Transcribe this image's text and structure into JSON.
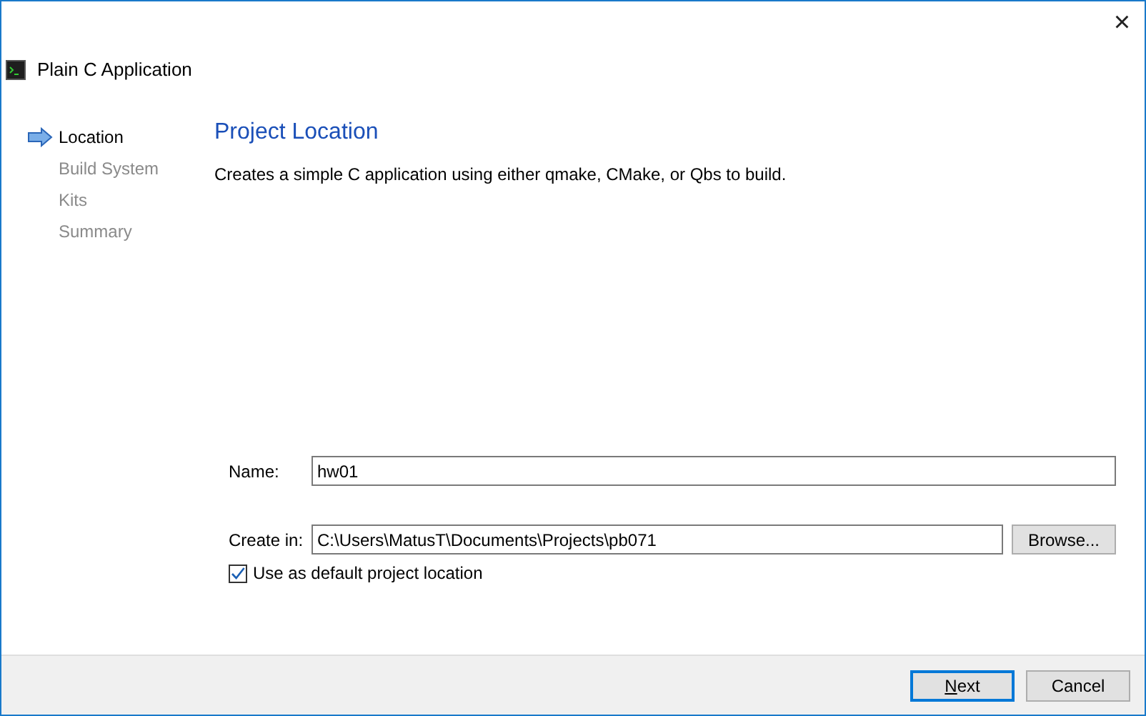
{
  "window": {
    "title": "Plain C Application",
    "close": "×"
  },
  "steps": [
    {
      "label": "Location",
      "selected": true
    },
    {
      "label": "Build System",
      "selected": false
    },
    {
      "label": "Kits",
      "selected": false
    },
    {
      "label": "Summary",
      "selected": false
    }
  ],
  "page": {
    "heading": "Project Location",
    "description": "Creates a simple C application using either qmake, CMake, or Qbs to build."
  },
  "form": {
    "name_label": "Name:",
    "name_value": "hw01",
    "create_label": "Create in:",
    "create_value": "C:\\Users\\MatusT\\Documents\\Projects\\pb071",
    "browse": "Browse...",
    "default_label": "Use as default project location",
    "default_checked": true
  },
  "buttons": [
    {
      "label": "Next",
      "default": true,
      "mnemonic_first": true
    },
    {
      "label": "Cancel",
      "default": false,
      "mnemonic_first": false
    }
  ]
}
